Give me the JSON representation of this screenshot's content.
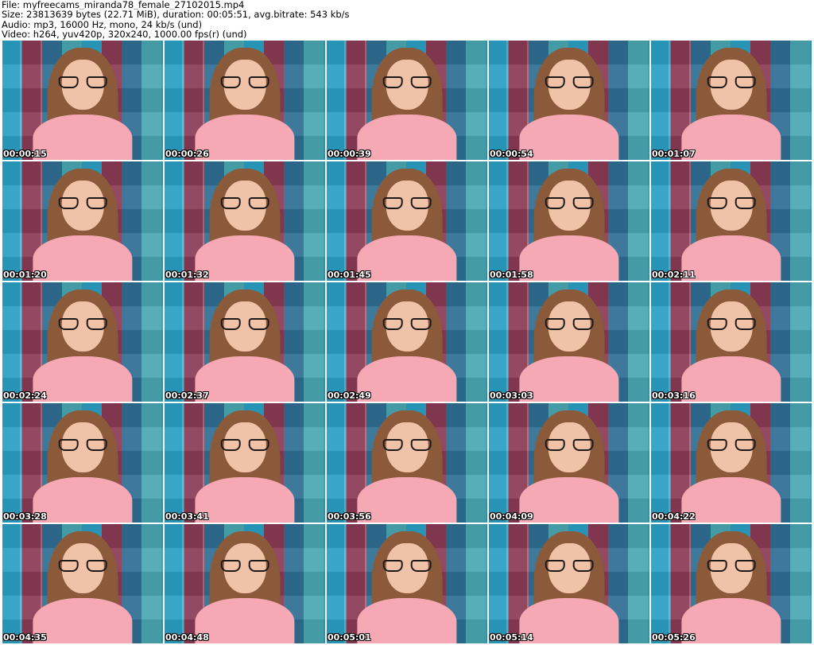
{
  "header": {
    "file_line": "File: myfreecams_miranda78_female_27102015.mp4",
    "size_line": "Size: 23813639 bytes (22.71 MiB), duration: 00:05:51, avg.bitrate: 543 kb/s",
    "audio_line": "Audio: mp3, 16000 Hz, mono, 24 kb/s (und)",
    "video_line": "Video: h264, yuv420p, 320x240, 1000.00 fps(r) (und)"
  },
  "thumbnails": [
    {
      "timestamp": "00:00:15"
    },
    {
      "timestamp": "00:00:26"
    },
    {
      "timestamp": "00:00:39"
    },
    {
      "timestamp": "00:00:54"
    },
    {
      "timestamp": "00:01:07"
    },
    {
      "timestamp": "00:01:20"
    },
    {
      "timestamp": "00:01:32"
    },
    {
      "timestamp": "00:01:45"
    },
    {
      "timestamp": "00:01:58"
    },
    {
      "timestamp": "00:02:11"
    },
    {
      "timestamp": "00:02:24"
    },
    {
      "timestamp": "00:02:37"
    },
    {
      "timestamp": "00:02:49"
    },
    {
      "timestamp": "00:03:03"
    },
    {
      "timestamp": "00:03:16"
    },
    {
      "timestamp": "00:03:28"
    },
    {
      "timestamp": "00:03:41"
    },
    {
      "timestamp": "00:03:56"
    },
    {
      "timestamp": "00:04:09"
    },
    {
      "timestamp": "00:04:22"
    },
    {
      "timestamp": "00:04:35"
    },
    {
      "timestamp": "00:04:48"
    },
    {
      "timestamp": "00:05:01"
    },
    {
      "timestamp": "00:05:14"
    },
    {
      "timestamp": "00:05:26"
    }
  ],
  "colors": {
    "background": "#ffffff",
    "header_text": "#000000",
    "timestamp_text": "#ffffff",
    "shirt": "#f6a9b4",
    "hair": "#8a5a3a"
  }
}
